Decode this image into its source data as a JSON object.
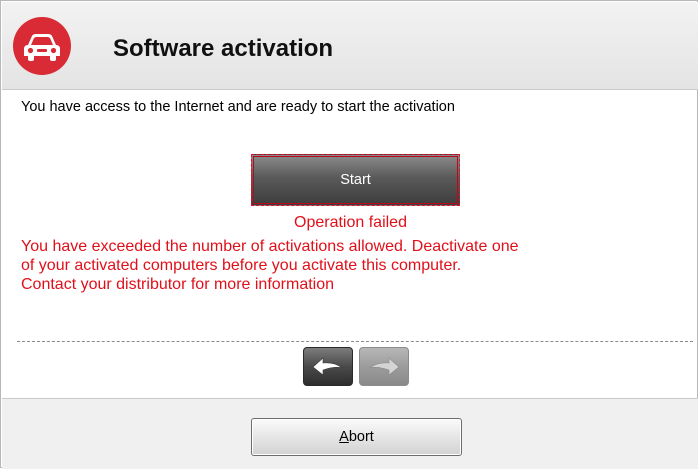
{
  "header": {
    "title": "Software activation",
    "logo_icon": "car-icon",
    "logo_color": "#d92b35"
  },
  "main": {
    "intro_text": "You have access to the Internet and are ready to start the activation",
    "start_label": "Start",
    "error_title": "Operation failed",
    "error_lines": [
      "You have exceeded the number of activations allowed. Deactivate one",
      "of your activated computers before you activate this computer.",
      "Contact your distributor for more information"
    ],
    "error_color": "#e0101a"
  },
  "navigation": {
    "back_icon": "back-arrow-icon",
    "back_enabled": true,
    "forward_icon": "forward-arrow-icon",
    "forward_enabled": false
  },
  "footer": {
    "abort_mnemonic": "A",
    "abort_rest": "bort"
  }
}
